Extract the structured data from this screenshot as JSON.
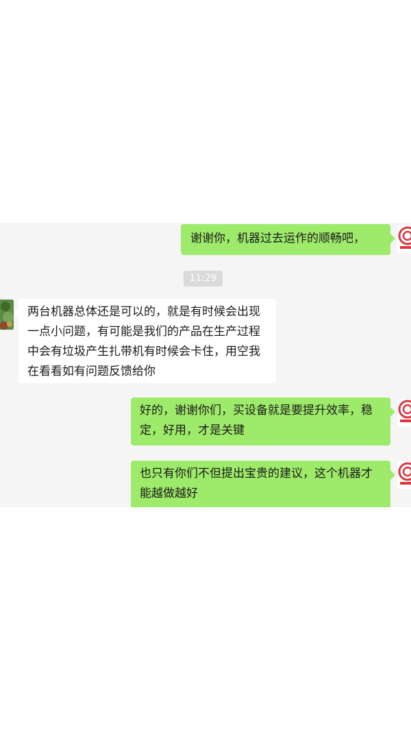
{
  "chat": {
    "timestamp": "11:29",
    "messages": [
      {
        "sender": "self",
        "text": "谢谢你，机器过去运作的顺畅吧，"
      },
      {
        "sender": "other",
        "text": "两台机器总体还是可以的，就是有时候会出现一点小问题，有可能是我们的产品在生产过程中会有垃圾产生扎带机有时候会卡住，用空我在看看如有问题反馈给你"
      },
      {
        "sender": "self",
        "text": "好的，谢谢你们，买设备就是要提升效率，稳定，好用，才是关键"
      },
      {
        "sender": "self",
        "text": "也只有你们不但提出宝贵的建议，这个机器才能越做越好"
      }
    ]
  },
  "colors": {
    "self_bubble": "#9eea6a",
    "other_bubble": "#ffffff",
    "panel_background": "#f5f5f5",
    "timestamp_background": "#dadada",
    "avatar_logo_red": "#d9363e"
  },
  "icons": {
    "self_avatar": "company-logo-avatar",
    "other_avatar": "plant-photo-avatar"
  }
}
